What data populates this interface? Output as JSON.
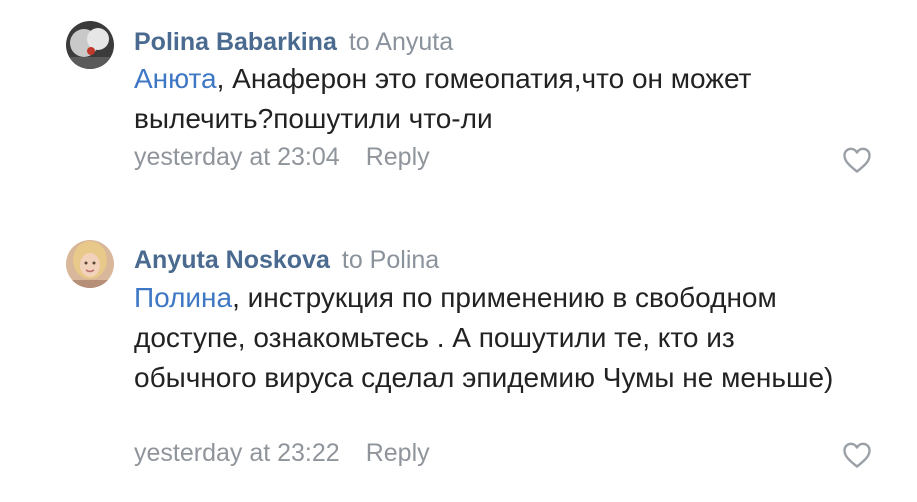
{
  "comments": [
    {
      "author": "Polina Babarkina",
      "reply_to": "to Anyuta",
      "mention": "Анюта",
      "text": ", Анаферон это гомеопатия,что он может вылечить?пошутили что-ли",
      "timestamp": "yesterday at 23:04",
      "reply_label": "Reply",
      "avatar_icon": "avatar-dark-photo",
      "like_icon": "heart-outline-icon"
    },
    {
      "author": "Anyuta Noskova",
      "reply_to": "to Polina",
      "mention": "Полина",
      "text": ", инструкция по применению в свободном доступе, ознакомьтесь . А пошутили те, кто из обычного вируса сделал эпидемию Чумы не меньше)",
      "timestamp": "yesterday at 23:22",
      "reply_label": "Reply",
      "avatar_icon": "avatar-blonde-photo",
      "like_icon": "heart-outline-icon"
    }
  ],
  "colors": {
    "author": "#4a6a8f",
    "mention": "#3e77c4",
    "meta": "#8f959b",
    "text": "#222222"
  }
}
